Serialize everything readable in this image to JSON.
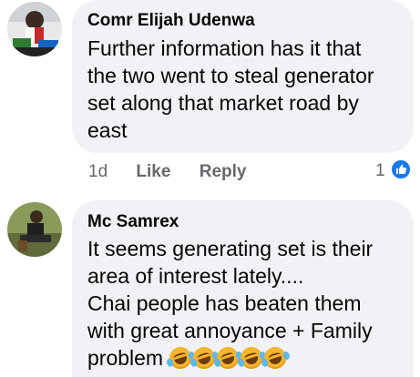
{
  "comments": [
    {
      "author": "Comr Elijah Udenwa",
      "lines": [
        "Further information has it that",
        "the two went to steal generator",
        "set along that market road by",
        "east"
      ],
      "time": "1d",
      "like_label": "Like",
      "reply_label": "Reply",
      "reaction_count": "1",
      "reaction_icon": "like-icon"
    },
    {
      "author": "Mc Samrex",
      "lines": [
        "It seems generating set is their",
        "area of interest lately....",
        "Chai people has beaten them",
        "with great annoyance + Family",
        "problem"
      ],
      "emojis": [
        "rofl-emoji",
        "rofl-emoji",
        "rofl-emoji",
        "rofl-emoji",
        "rofl-emoji"
      ]
    }
  ],
  "colors": {
    "bubble": "#f0f2f5",
    "meta_text": "#65676b",
    "like_blue": "#1877f2"
  }
}
